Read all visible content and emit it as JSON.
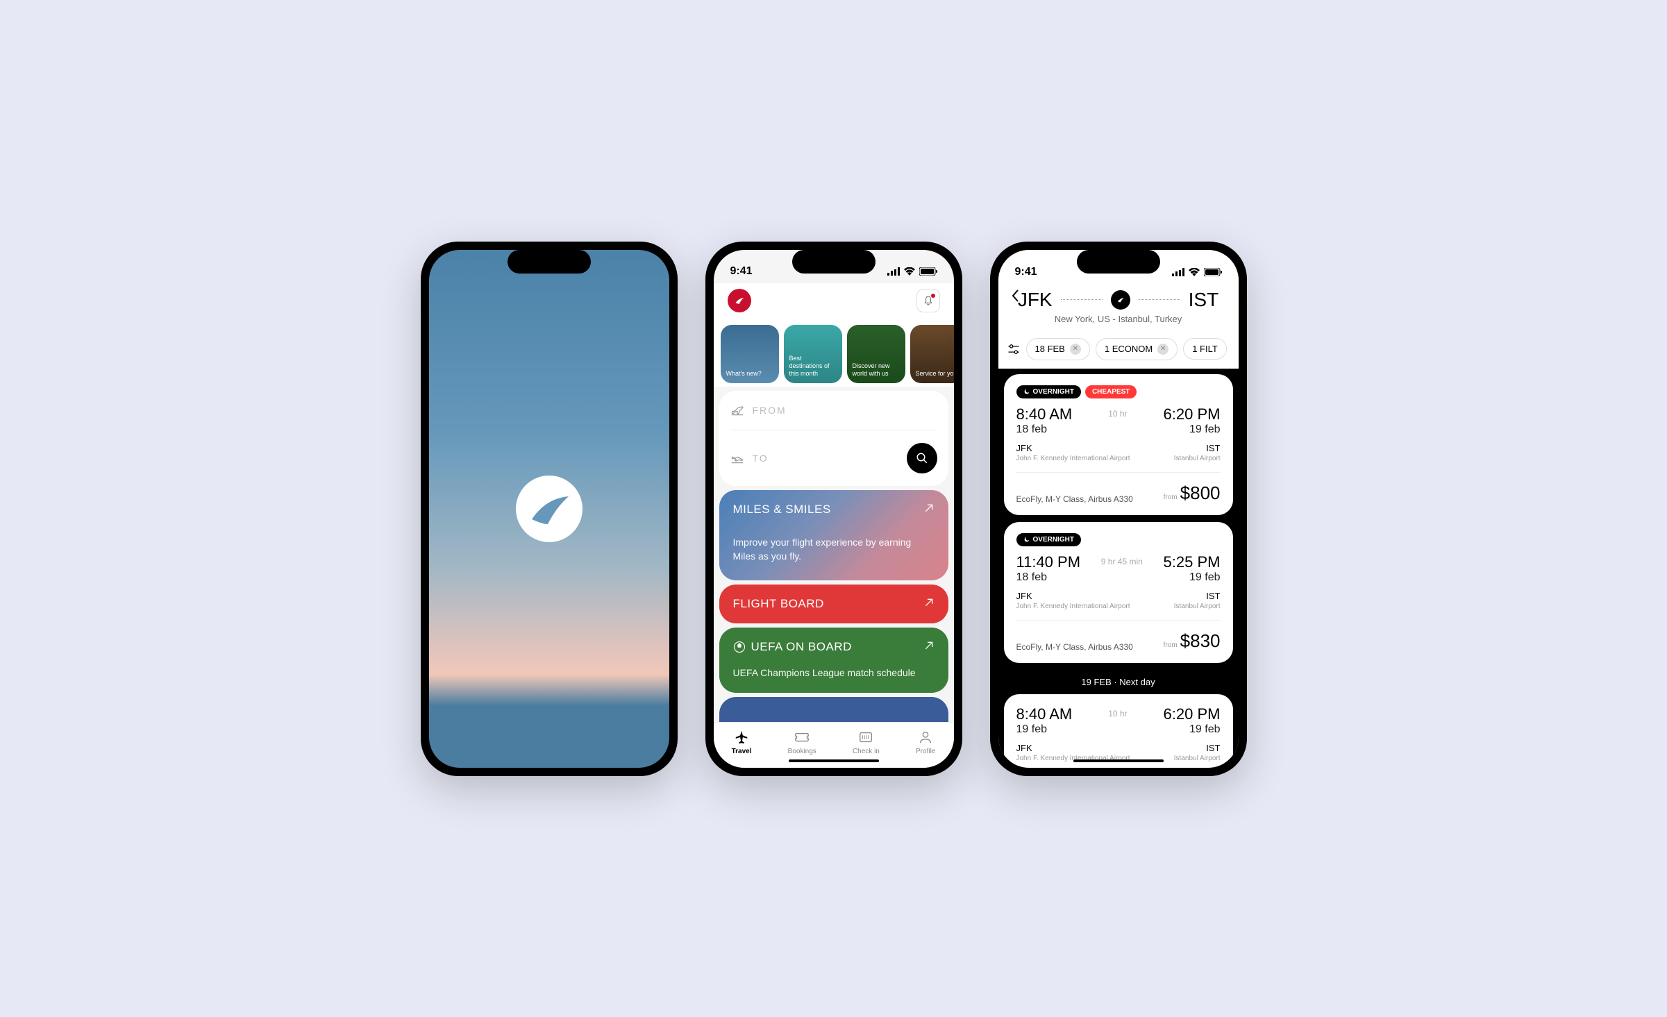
{
  "status": {
    "time": "9:41"
  },
  "home": {
    "stories": [
      {
        "label": "What's new?"
      },
      {
        "label": "Best destinations of this month"
      },
      {
        "label": "Discover new world with us"
      },
      {
        "label": "Service for you"
      }
    ],
    "search": {
      "from": "FROM",
      "to": "TO"
    },
    "miles": {
      "title": "MILES & SMILES",
      "desc": "Improve your flight experience by earning Miles as you fly."
    },
    "flightboard": {
      "title": "FLIGHT BOARD"
    },
    "uefa": {
      "title": "UEFA ON BOARD",
      "desc": "UEFA Champions League match schedule"
    },
    "tabs": {
      "travel": "Travel",
      "bookings": "Bookings",
      "checkin": "Check in",
      "profile": "Profile"
    }
  },
  "results": {
    "origin": "JFK",
    "dest": "IST",
    "subtitle": "New York, US - Istanbul, Turkey",
    "filters": {
      "date": "18 FEB",
      "class": "1 ECONOM",
      "more": "1 FILT"
    },
    "flights": [
      {
        "badges": {
          "overnight": "OVERNIGHT",
          "cheapest": "CHEAPEST"
        },
        "depTime": "8:40 AM",
        "depDate": "18 feb",
        "arrTime": "6:20 PM",
        "arrDate": "19 feb",
        "duration": "10 hr",
        "depCode": "JFK",
        "depName": "John F. Kennedy International Airport",
        "arrCode": "IST",
        "arrName": "Istanbul Airport",
        "fare": "EcoFly, M-Y Class,  Airbus A330",
        "fromLabel": "from",
        "price": "$800"
      },
      {
        "badges": {
          "overnight": "OVERNIGHT"
        },
        "depTime": "11:40 PM",
        "depDate": "18 feb",
        "arrTime": "5:25 PM",
        "arrDate": "19 feb",
        "duration": "9 hr 45 min",
        "depCode": "JFK",
        "depName": "John F. Kennedy International Airport",
        "arrCode": "IST",
        "arrName": "Istanbul Airport",
        "fare": "EcoFly, M-Y Class,  Airbus A330",
        "fromLabel": "from",
        "price": "$830"
      },
      {
        "depTime": "8:40 AM",
        "depDate": "19 feb",
        "arrTime": "6:20 PM",
        "arrDate": "19 feb",
        "duration": "10 hr",
        "depCode": "JFK",
        "depName": "John F. Kennedy International Airport",
        "arrCode": "IST",
        "arrName": "Istanbul Airport"
      }
    ],
    "divider": "19 FEB · Next day"
  }
}
